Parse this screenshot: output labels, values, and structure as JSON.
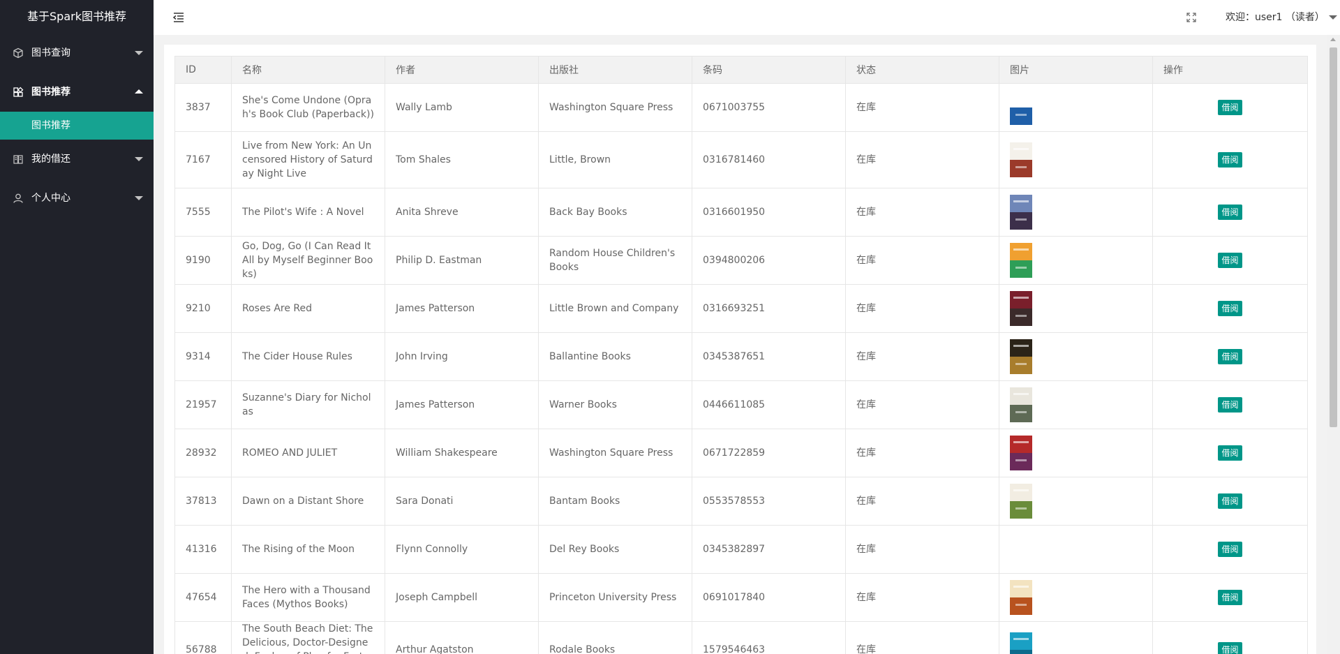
{
  "app": {
    "title": "基于Spark图书推荐"
  },
  "sidebar": {
    "items": [
      {
        "label": "图书查询",
        "icon": "cube-icon",
        "expanded": false
      },
      {
        "label": "图书推荐",
        "icon": "apps-icon",
        "expanded": true,
        "children": [
          {
            "label": "图书推荐",
            "active": true
          }
        ]
      },
      {
        "label": "我的借还",
        "icon": "book-icon",
        "expanded": false
      },
      {
        "label": "个人中心",
        "icon": "user-icon",
        "expanded": false
      }
    ]
  },
  "header": {
    "welcome": "欢迎：user1 （读者）"
  },
  "table": {
    "columns": [
      "ID",
      "名称",
      "作者",
      "出版社",
      "条码",
      "状态",
      "图片",
      "操作"
    ],
    "action_label": "借阅",
    "rows": [
      {
        "id": "3837",
        "name": "She's Come Undone (Oprah's Book Club (Paperback))",
        "author": "Wally Lamb",
        "publisher": "Washington Square Press",
        "barcode": "0671003755",
        "status": "在库",
        "cover": [
          "#ffffff",
          "#1f5fa8"
        ]
      },
      {
        "id": "7167",
        "name": "Live from New York: An Uncensored History of Saturday Night Live",
        "author": "Tom Shales",
        "publisher": "Little, Brown",
        "barcode": "0316781460",
        "status": "在库",
        "cover": [
          "#f4f1ea",
          "#9b3a2a"
        ]
      },
      {
        "id": "7555",
        "name": "The Pilot's Wife : A Novel",
        "author": "Anita Shreve",
        "publisher": "Back Bay Books",
        "barcode": "0316601950",
        "status": "在库",
        "cover": [
          "#6f86b8",
          "#3c2f4a"
        ]
      },
      {
        "id": "9190",
        "name": "Go, Dog, Go (I Can Read It All by Myself Beginner Books)",
        "author": "Philip D. Eastman",
        "publisher": "Random House Children's Books",
        "barcode": "0394800206",
        "status": "在库",
        "cover": [
          "#f0a030",
          "#2e9e57"
        ]
      },
      {
        "id": "9210",
        "name": "Roses Are Red",
        "author": "James Patterson",
        "publisher": "Little Brown and Company",
        "barcode": "0316693251",
        "status": "在库",
        "cover": [
          "#7a1f2b",
          "#3b2a2a"
        ]
      },
      {
        "id": "9314",
        "name": "The Cider House Rules",
        "author": "John Irving",
        "publisher": "Ballantine Books",
        "barcode": "0345387651",
        "status": "在库",
        "cover": [
          "#2b2418",
          "#a87d2c"
        ]
      },
      {
        "id": "21957",
        "name": "Suzanne's Diary for Nicholas",
        "author": "James Patterson",
        "publisher": "Warner Books",
        "barcode": "0446611085",
        "status": "在库",
        "cover": [
          "#e9e6dd",
          "#5e6a55"
        ]
      },
      {
        "id": "28932",
        "name": "ROMEO AND JULIET",
        "author": "William Shakespeare",
        "publisher": "Washington Square Press",
        "barcode": "0671722859",
        "status": "在库",
        "cover": [
          "#b52a2a",
          "#6b2a5a"
        ]
      },
      {
        "id": "37813",
        "name": "Dawn on a Distant Shore",
        "author": "Sara Donati",
        "publisher": "Bantam Books",
        "barcode": "0553578553",
        "status": "在库",
        "cover": [
          "#f2ede2",
          "#6a8c3a"
        ]
      },
      {
        "id": "41316",
        "name": "The Rising of the Moon",
        "author": "Flynn Connolly",
        "publisher": "Del Rey Books",
        "barcode": "0345382897",
        "status": "在库",
        "cover": []
      },
      {
        "id": "47654",
        "name": "The Hero with a Thousand Faces (Mythos Books)",
        "author": "Joseph Campbell",
        "publisher": "Princeton University Press",
        "barcode": "0691017840",
        "status": "在库",
        "cover": [
          "#f3e3c0",
          "#b8521e"
        ]
      },
      {
        "id": "56788",
        "name": "The South Beach Diet: The Delicious, Doctor-Designed, Foolproof Plan for Fast and Healthy Weight Loss",
        "author": "Arthur Agatston",
        "publisher": "Rodale Books",
        "barcode": "1579546463",
        "status": "在库",
        "cover": [
          "#1aa0c4",
          "#0d6b8c"
        ]
      }
    ]
  },
  "colors": {
    "sidebar_bg": "#20222a",
    "accent": "#16a391",
    "button": "#009688"
  }
}
